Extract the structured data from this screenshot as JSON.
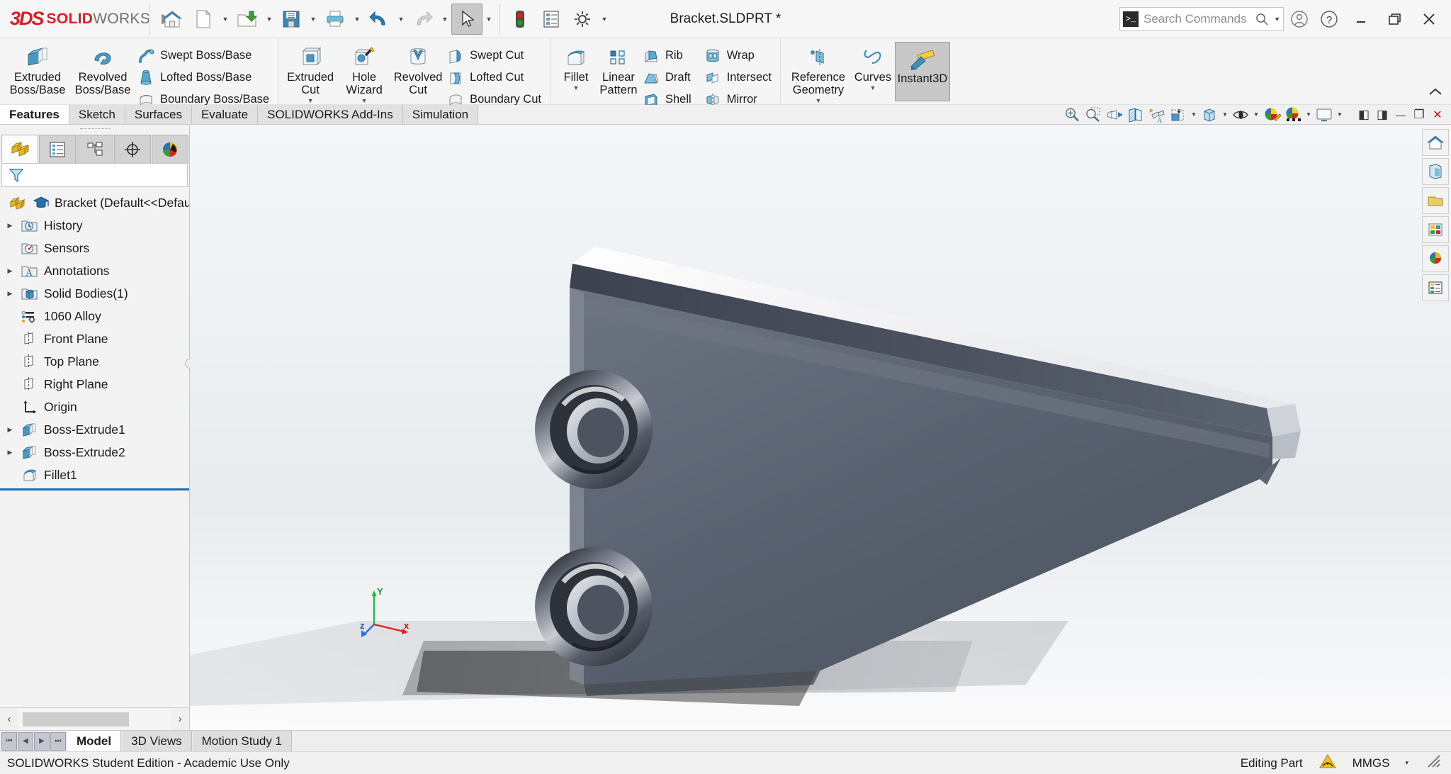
{
  "app": {
    "brand_ds": "3DS",
    "brand_solid": "SOLID",
    "brand_works": "WORKS",
    "document_title": "Bracket.SLDPRT *",
    "accent_red": "#d81f26",
    "accent_blue": "#1a6fb5"
  },
  "titlebar": {
    "quick_access": [
      {
        "name": "home-icon",
        "label": "Home"
      },
      {
        "name": "new-document-icon",
        "label": "New"
      },
      {
        "name": "open-folder-icon",
        "label": "Open"
      },
      {
        "name": "save-icon",
        "label": "Save"
      },
      {
        "name": "print-icon",
        "label": "Print"
      },
      {
        "name": "undo-icon",
        "label": "Undo"
      },
      {
        "name": "redo-icon",
        "label": "Redo"
      },
      {
        "name": "select-cursor-icon",
        "label": "Select"
      },
      {
        "name": "rebuild-traffic-light-icon",
        "label": "Rebuild"
      },
      {
        "name": "file-properties-icon",
        "label": "File Properties"
      },
      {
        "name": "options-gear-icon",
        "label": "Options"
      }
    ],
    "search": {
      "placeholder": "Search Commands",
      "prompt_glyph": ">_"
    },
    "right_buttons": [
      {
        "name": "user-account-icon",
        "label": "Account"
      },
      {
        "name": "help-icon",
        "label": "Help"
      },
      {
        "name": "minimize-button",
        "label": "Minimize"
      },
      {
        "name": "restore-button",
        "label": "Restore"
      },
      {
        "name": "close-button",
        "label": "Close"
      }
    ]
  },
  "ribbon": {
    "groups": [
      {
        "big": [
          {
            "label_line1": "Extruded",
            "label_line2": "Boss/Base",
            "icon": "extruded-boss-icon",
            "dropdown": false
          },
          {
            "label_line1": "Revolved",
            "label_line2": "Boss/Base",
            "icon": "revolved-boss-icon",
            "dropdown": false
          }
        ],
        "small": [
          {
            "label": "Swept Boss/Base",
            "icon": "swept-boss-icon"
          },
          {
            "label": "Lofted Boss/Base",
            "icon": "lofted-boss-icon"
          },
          {
            "label": "Boundary Boss/Base",
            "icon": "boundary-boss-icon"
          }
        ]
      },
      {
        "big": [
          {
            "label_line1": "Extruded",
            "label_line2": "Cut",
            "icon": "extruded-cut-icon",
            "dropdown": true
          },
          {
            "label_line1": "Hole",
            "label_line2": "Wizard",
            "icon": "hole-wizard-icon",
            "dropdown": true
          },
          {
            "label_line1": "Revolved",
            "label_line2": "Cut",
            "icon": "revolved-cut-icon",
            "dropdown": false
          }
        ],
        "small": [
          {
            "label": "Swept Cut",
            "icon": "swept-cut-icon"
          },
          {
            "label": "Lofted Cut",
            "icon": "lofted-cut-icon"
          },
          {
            "label": "Boundary Cut",
            "icon": "boundary-cut-icon"
          }
        ]
      },
      {
        "big": [
          {
            "label_line1": "Fillet",
            "label_line2": "",
            "icon": "fillet-icon",
            "dropdown": true
          },
          {
            "label_line1": "Linear",
            "label_line2": "Pattern",
            "icon": "linear-pattern-icon",
            "dropdown": true
          }
        ],
        "small": [
          {
            "label": "Rib",
            "icon": "rib-icon"
          },
          {
            "label": "Draft",
            "icon": "draft-icon"
          },
          {
            "label": "Shell",
            "icon": "shell-icon"
          }
        ],
        "small2": [
          {
            "label": "Wrap",
            "icon": "wrap-icon"
          },
          {
            "label": "Intersect",
            "icon": "intersect-icon"
          },
          {
            "label": "Mirror",
            "icon": "mirror-icon"
          }
        ]
      },
      {
        "big": [
          {
            "label_line1": "Reference",
            "label_line2": "Geometry",
            "icon": "reference-geometry-icon",
            "dropdown": true
          },
          {
            "label_line1": "Curves",
            "label_line2": "",
            "icon": "curves-icon",
            "dropdown": true
          }
        ],
        "small": []
      }
    ],
    "instant3d": {
      "label": "Instant3D",
      "icon": "instant3d-icon",
      "active": true
    },
    "collapse": {
      "name": "collapse-ribbon-icon",
      "glyph": "∧"
    }
  },
  "tabs": {
    "items": [
      {
        "label": "Features",
        "active": true
      },
      {
        "label": "Sketch",
        "active": false
      },
      {
        "label": "Surfaces",
        "active": false
      },
      {
        "label": "Evaluate",
        "active": false
      },
      {
        "label": "SOLIDWORKS Add-Ins",
        "active": false
      },
      {
        "label": "Simulation",
        "active": false
      }
    ],
    "view_toolbar": [
      {
        "name": "zoom-to-fit-icon",
        "caret": false
      },
      {
        "name": "zoom-to-area-icon",
        "caret": false
      },
      {
        "name": "previous-view-icon",
        "caret": false
      },
      {
        "name": "section-view-icon",
        "caret": false
      },
      {
        "name": "view-orientation-icon",
        "caret": false
      },
      {
        "name": "view-orientation-cube-icon",
        "caret": true
      },
      {
        "name": "display-style-icon",
        "caret": true
      },
      {
        "name": "hide-show-items-icon",
        "caret": true
      },
      {
        "name": "edit-appearance-icon",
        "caret": false
      },
      {
        "name": "apply-scene-icon",
        "caret": true
      },
      {
        "name": "view-settings-icon",
        "caret": true
      }
    ],
    "window_controls": [
      {
        "name": "panel-left-icon",
        "glyph": "◧"
      },
      {
        "name": "panel-right-icon",
        "glyph": "◨"
      },
      {
        "name": "minimize-doc-button",
        "glyph": "—"
      },
      {
        "name": "restore-doc-button",
        "glyph": "❐"
      },
      {
        "name": "close-doc-button",
        "glyph": "✕"
      }
    ]
  },
  "feature_manager": {
    "tabs": [
      {
        "name": "feature-tree-tab",
        "icon": "feature-tree-icon",
        "active": true
      },
      {
        "name": "property-manager-tab",
        "icon": "property-manager-icon",
        "active": false
      },
      {
        "name": "configuration-manager-tab",
        "icon": "configuration-manager-icon",
        "active": false
      },
      {
        "name": "dimxpert-manager-tab",
        "icon": "dimxpert-icon",
        "active": false
      },
      {
        "name": "display-manager-tab",
        "icon": "display-manager-icon",
        "active": false
      }
    ],
    "filter": {
      "name": "filter-icon",
      "placeholder": ""
    },
    "tree": [
      {
        "label": "Bracket  (Default<<Defaul",
        "icon": "part-icon",
        "expand": false,
        "indent": 0,
        "extra_icon": "graduation-cap-icon"
      },
      {
        "label": "History",
        "icon": "history-icon",
        "expand": true,
        "indent": 1
      },
      {
        "label": "Sensors",
        "icon": "sensors-icon",
        "expand": false,
        "indent": 1
      },
      {
        "label": "Annotations",
        "icon": "annotations-icon",
        "expand": true,
        "indent": 1
      },
      {
        "label": "Solid Bodies(1)",
        "icon": "solid-bodies-icon",
        "expand": true,
        "indent": 1
      },
      {
        "label": "1060 Alloy",
        "icon": "material-icon",
        "expand": false,
        "indent": 1
      },
      {
        "label": "Front Plane",
        "icon": "plane-icon",
        "expand": false,
        "indent": 1
      },
      {
        "label": "Top Plane",
        "icon": "plane-icon",
        "expand": false,
        "indent": 1
      },
      {
        "label": "Right Plane",
        "icon": "plane-icon",
        "expand": false,
        "indent": 1
      },
      {
        "label": "Origin",
        "icon": "origin-icon",
        "expand": false,
        "indent": 1
      },
      {
        "label": "Boss-Extrude1",
        "icon": "extrude-feature-icon",
        "expand": true,
        "indent": 1
      },
      {
        "label": "Boss-Extrude2",
        "icon": "extrude-feature-icon",
        "expand": true,
        "indent": 1
      },
      {
        "label": "Fillet1",
        "icon": "fillet-feature-icon",
        "expand": false,
        "indent": 1
      }
    ],
    "scroll": {
      "left_arrow": "‹",
      "right_arrow": "›"
    }
  },
  "graphics": {
    "triad": {
      "x_label": "x",
      "y_label": "Y",
      "z_label": "z"
    },
    "right_strip": [
      {
        "name": "view-home-icon"
      },
      {
        "name": "appearances-icon"
      },
      {
        "name": "scenes-icon"
      },
      {
        "name": "decals-icon"
      },
      {
        "name": "lights-cameras-icon"
      },
      {
        "name": "custom-views-icon"
      }
    ]
  },
  "bottom": {
    "nav": [
      {
        "name": "first-tab-button",
        "glyph": "⏮"
      },
      {
        "name": "prev-tab-button",
        "glyph": "◀"
      },
      {
        "name": "next-tab-button",
        "glyph": "▶"
      },
      {
        "name": "last-tab-button",
        "glyph": "⏭"
      }
    ],
    "doc_tabs": [
      {
        "label": "Model",
        "active": true
      },
      {
        "label": "3D Views",
        "active": false
      },
      {
        "label": "Motion Study 1",
        "active": false
      }
    ],
    "status_left": "SOLIDWORKS Student Edition - Academic Use Only",
    "status_editing": "Editing Part",
    "status_units": "MMGS",
    "status_warning_icon": "warning-icon",
    "status_units_caret": "▾",
    "status_resize_icon": "resize-grip-icon"
  }
}
